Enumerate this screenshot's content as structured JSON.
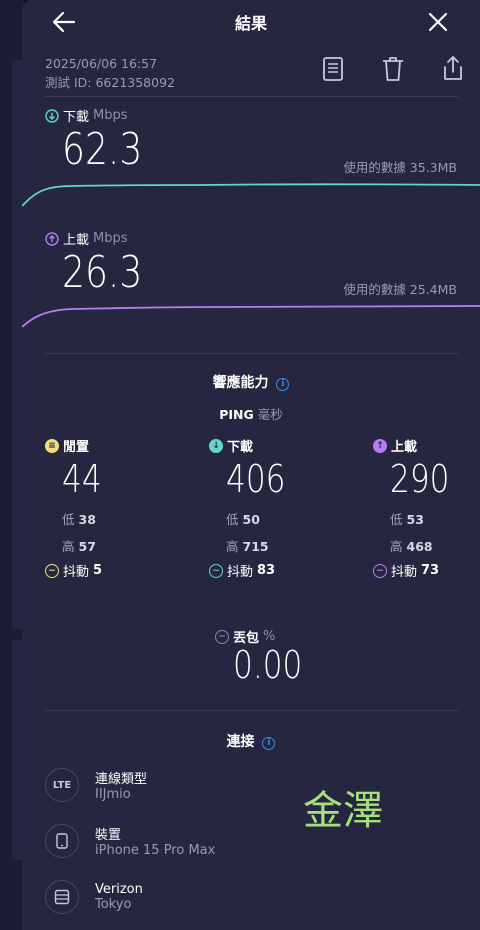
{
  "header": {
    "title": "結果"
  },
  "meta": {
    "datetime": "2025/06/06 16:57",
    "test_id": "測試 ID: 6621358092"
  },
  "download": {
    "label": "下載",
    "unit": "Mbps",
    "value": "62.3",
    "data_used": "使用的數據 35.3MB",
    "color": "#5fd8c8"
  },
  "upload": {
    "label": "上載",
    "unit": "Mbps",
    "value": "26.3",
    "data_used": "使用的數據 25.4MB",
    "color": "#b87cf0"
  },
  "responsiveness": {
    "title": "響應能力",
    "ping_label": "PING",
    "ping_unit": "毫秒",
    "idle": {
      "label": "閒置",
      "value": "44",
      "low_label": "低",
      "low": "38",
      "high_label": "高",
      "high": "57",
      "jitter_label": "抖動",
      "jitter": "5",
      "color": "#f0e07a"
    },
    "download": {
      "label": "下載",
      "value": "406",
      "low_label": "低",
      "low": "50",
      "high_label": "高",
      "high": "715",
      "jitter_label": "抖動",
      "jitter": "83",
      "color": "#5fd8c8"
    },
    "upload": {
      "label": "上載",
      "value": "290",
      "low_label": "低",
      "low": "53",
      "high_label": "高",
      "high": "468",
      "jitter_label": "抖動",
      "jitter": "73",
      "color": "#b87cf0"
    }
  },
  "packet_loss": {
    "label": "丟包",
    "unit": "%",
    "value": "0.00"
  },
  "connection": {
    "title": "連接",
    "items": [
      {
        "icon": "LTE",
        "title": "連線類型",
        "subtitle": "IIJmio"
      },
      {
        "icon": "phone-icon",
        "title": "裝置",
        "subtitle": "iPhone 15 Pro Max"
      },
      {
        "icon": "server-icon",
        "title": "Verizon",
        "subtitle": "Tokyo"
      }
    ]
  },
  "watermark": {
    "text": "金澤",
    "color": "#a6e07c"
  },
  "accent": "#3a8ee6"
}
